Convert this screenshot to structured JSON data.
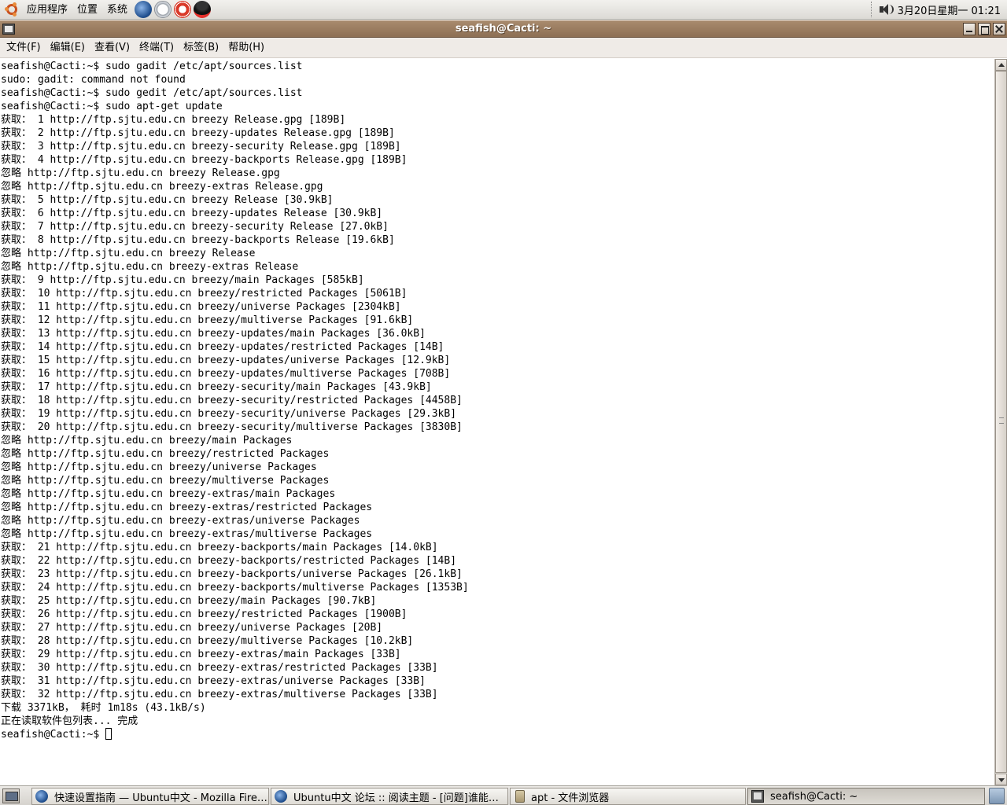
{
  "top_panel": {
    "menus": [
      "应用程序",
      "位置",
      "系统"
    ],
    "launchers": [
      "firefox-icon",
      "clock-icon",
      "help-icon",
      "qq-icon"
    ],
    "clock": "3月20日星期一 01:21"
  },
  "window": {
    "title": "seafish@Cacti: ~",
    "menu": [
      "文件(F)",
      "编辑(E)",
      "查看(V)",
      "终端(T)",
      "标签(B)",
      "帮助(H)"
    ]
  },
  "terminal": {
    "lines": [
      "seafish@Cacti:~$ sudo gadit /etc/apt/sources.list",
      "sudo: gadit: command not found",
      "seafish@Cacti:~$ sudo gedit /etc/apt/sources.list",
      "seafish@Cacti:~$ sudo apt-get update",
      "获取： 1 http://ftp.sjtu.edu.cn breezy Release.gpg [189B]",
      "获取： 2 http://ftp.sjtu.edu.cn breezy-updates Release.gpg [189B]",
      "获取： 3 http://ftp.sjtu.edu.cn breezy-security Release.gpg [189B]",
      "获取： 4 http://ftp.sjtu.edu.cn breezy-backports Release.gpg [189B]",
      "忽略 http://ftp.sjtu.edu.cn breezy Release.gpg",
      "忽略 http://ftp.sjtu.edu.cn breezy-extras Release.gpg",
      "获取： 5 http://ftp.sjtu.edu.cn breezy Release [30.9kB]",
      "获取： 6 http://ftp.sjtu.edu.cn breezy-updates Release [30.9kB]",
      "获取： 7 http://ftp.sjtu.edu.cn breezy-security Release [27.0kB]",
      "获取： 8 http://ftp.sjtu.edu.cn breezy-backports Release [19.6kB]",
      "忽略 http://ftp.sjtu.edu.cn breezy Release",
      "忽略 http://ftp.sjtu.edu.cn breezy-extras Release",
      "获取： 9 http://ftp.sjtu.edu.cn breezy/main Packages [585kB]",
      "获取： 10 http://ftp.sjtu.edu.cn breezy/restricted Packages [5061B]",
      "获取： 11 http://ftp.sjtu.edu.cn breezy/universe Packages [2304kB]",
      "获取： 12 http://ftp.sjtu.edu.cn breezy/multiverse Packages [91.6kB]",
      "获取： 13 http://ftp.sjtu.edu.cn breezy-updates/main Packages [36.0kB]",
      "获取： 14 http://ftp.sjtu.edu.cn breezy-updates/restricted Packages [14B]",
      "获取： 15 http://ftp.sjtu.edu.cn breezy-updates/universe Packages [12.9kB]",
      "获取： 16 http://ftp.sjtu.edu.cn breezy-updates/multiverse Packages [708B]",
      "获取： 17 http://ftp.sjtu.edu.cn breezy-security/main Packages [43.9kB]",
      "获取： 18 http://ftp.sjtu.edu.cn breezy-security/restricted Packages [4458B]",
      "获取： 19 http://ftp.sjtu.edu.cn breezy-security/universe Packages [29.3kB]",
      "获取： 20 http://ftp.sjtu.edu.cn breezy-security/multiverse Packages [3830B]",
      "忽略 http://ftp.sjtu.edu.cn breezy/main Packages",
      "忽略 http://ftp.sjtu.edu.cn breezy/restricted Packages",
      "忽略 http://ftp.sjtu.edu.cn breezy/universe Packages",
      "忽略 http://ftp.sjtu.edu.cn breezy/multiverse Packages",
      "忽略 http://ftp.sjtu.edu.cn breezy-extras/main Packages",
      "忽略 http://ftp.sjtu.edu.cn breezy-extras/restricted Packages",
      "忽略 http://ftp.sjtu.edu.cn breezy-extras/universe Packages",
      "忽略 http://ftp.sjtu.edu.cn breezy-extras/multiverse Packages",
      "获取： 21 http://ftp.sjtu.edu.cn breezy-backports/main Packages [14.0kB]",
      "获取： 22 http://ftp.sjtu.edu.cn breezy-backports/restricted Packages [14B]",
      "获取： 23 http://ftp.sjtu.edu.cn breezy-backports/universe Packages [26.1kB]",
      "获取： 24 http://ftp.sjtu.edu.cn breezy-backports/multiverse Packages [1353B]",
      "获取： 25 http://ftp.sjtu.edu.cn breezy/main Packages [90.7kB]",
      "获取： 26 http://ftp.sjtu.edu.cn breezy/restricted Packages [1900B]",
      "获取： 27 http://ftp.sjtu.edu.cn breezy/universe Packages [20B]",
      "获取： 28 http://ftp.sjtu.edu.cn breezy/multiverse Packages [10.2kB]",
      "获取： 29 http://ftp.sjtu.edu.cn breezy-extras/main Packages [33B]",
      "获取： 30 http://ftp.sjtu.edu.cn breezy-extras/restricted Packages [33B]",
      "获取： 31 http://ftp.sjtu.edu.cn breezy-extras/universe Packages [33B]",
      "获取： 32 http://ftp.sjtu.edu.cn breezy-extras/multiverse Packages [33B]",
      "下载 3371kB， 耗时 1m18s (43.1kB/s)",
      "正在读取软件包列表... 完成"
    ],
    "prompt": "seafish@Cacti:~$ "
  },
  "taskbar": {
    "tasks": [
      {
        "label": "快速设置指南 — Ubuntu中文 - Mozilla Fire…",
        "icon": "firefox-icon",
        "active": false
      },
      {
        "label": "Ubuntu中文 论坛 :: 阅读主题 - [问题]谁能…",
        "icon": "firefox-icon",
        "active": false
      },
      {
        "label": "apt - 文件浏览器",
        "icon": "folder-icon",
        "active": false
      },
      {
        "label": "seafish@Cacti: ~",
        "icon": "terminal-icon",
        "active": true
      }
    ]
  },
  "colors": {
    "titlebar": "#9b7c60",
    "panel": "#dcdad5",
    "terminal_bg": "#ffffff",
    "terminal_fg": "#000000"
  }
}
